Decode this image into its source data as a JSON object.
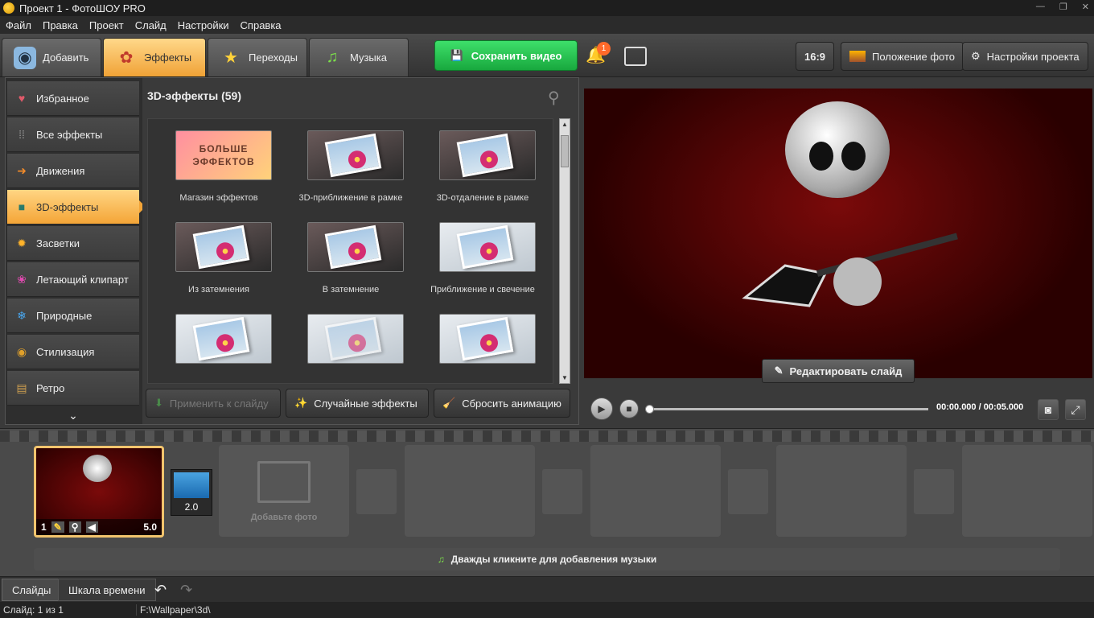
{
  "window": {
    "title": "Проект 1 - ФотоШОУ PRO"
  },
  "menu": [
    "Файл",
    "Правка",
    "Проект",
    "Слайд",
    "Настройки",
    "Справка"
  ],
  "tabs": [
    "Добавить",
    "Эффекты",
    "Переходы",
    "Музыка"
  ],
  "save_video": "Сохранить видео",
  "notifications": {
    "count": "1"
  },
  "right_buttons": {
    "ratio": "16:9",
    "photo_position": "Положение фото",
    "project_settings": "Настройки проекта"
  },
  "categories": [
    "Избранное",
    "Все эффекты",
    "Движения",
    "3D-эффекты",
    "Засветки",
    "Летающий клипарт",
    "Природные",
    "Стилизация",
    "Ретро"
  ],
  "effects_header": "3D-эффекты (59)",
  "effects": [
    {
      "label": "Магазин эффектов",
      "shop_text": "БОЛЬШЕ ЭФФЕКТОВ"
    },
    {
      "label": "3D-приближение в рамке"
    },
    {
      "label": "3D-отдаление в рамке"
    },
    {
      "label": "Из затемнения"
    },
    {
      "label": "В затемнение"
    },
    {
      "label": "Приближение и свечение"
    },
    {
      "label": ""
    },
    {
      "label": ""
    },
    {
      "label": ""
    }
  ],
  "effect_buttons": {
    "apply": "Применить к слайду",
    "random": "Случайные эффекты",
    "reset": "Сбросить анимацию"
  },
  "preview": {
    "edit_slide": "Редактировать слайд",
    "timecode": "00:00.000 / 00:05.000"
  },
  "timeline": {
    "slide1": {
      "index": "1",
      "duration": "5.0"
    },
    "transition": {
      "duration": "2.0"
    },
    "add_photo": "Добавьте фото",
    "music_hint": "Дважды кликните для добавления музыки"
  },
  "bottom_tabs": [
    "Слайды",
    "Шкала времени"
  ],
  "status": {
    "slide": "Слайд: 1 из 1",
    "path": "F:\\Wallpaper\\3d\\"
  }
}
